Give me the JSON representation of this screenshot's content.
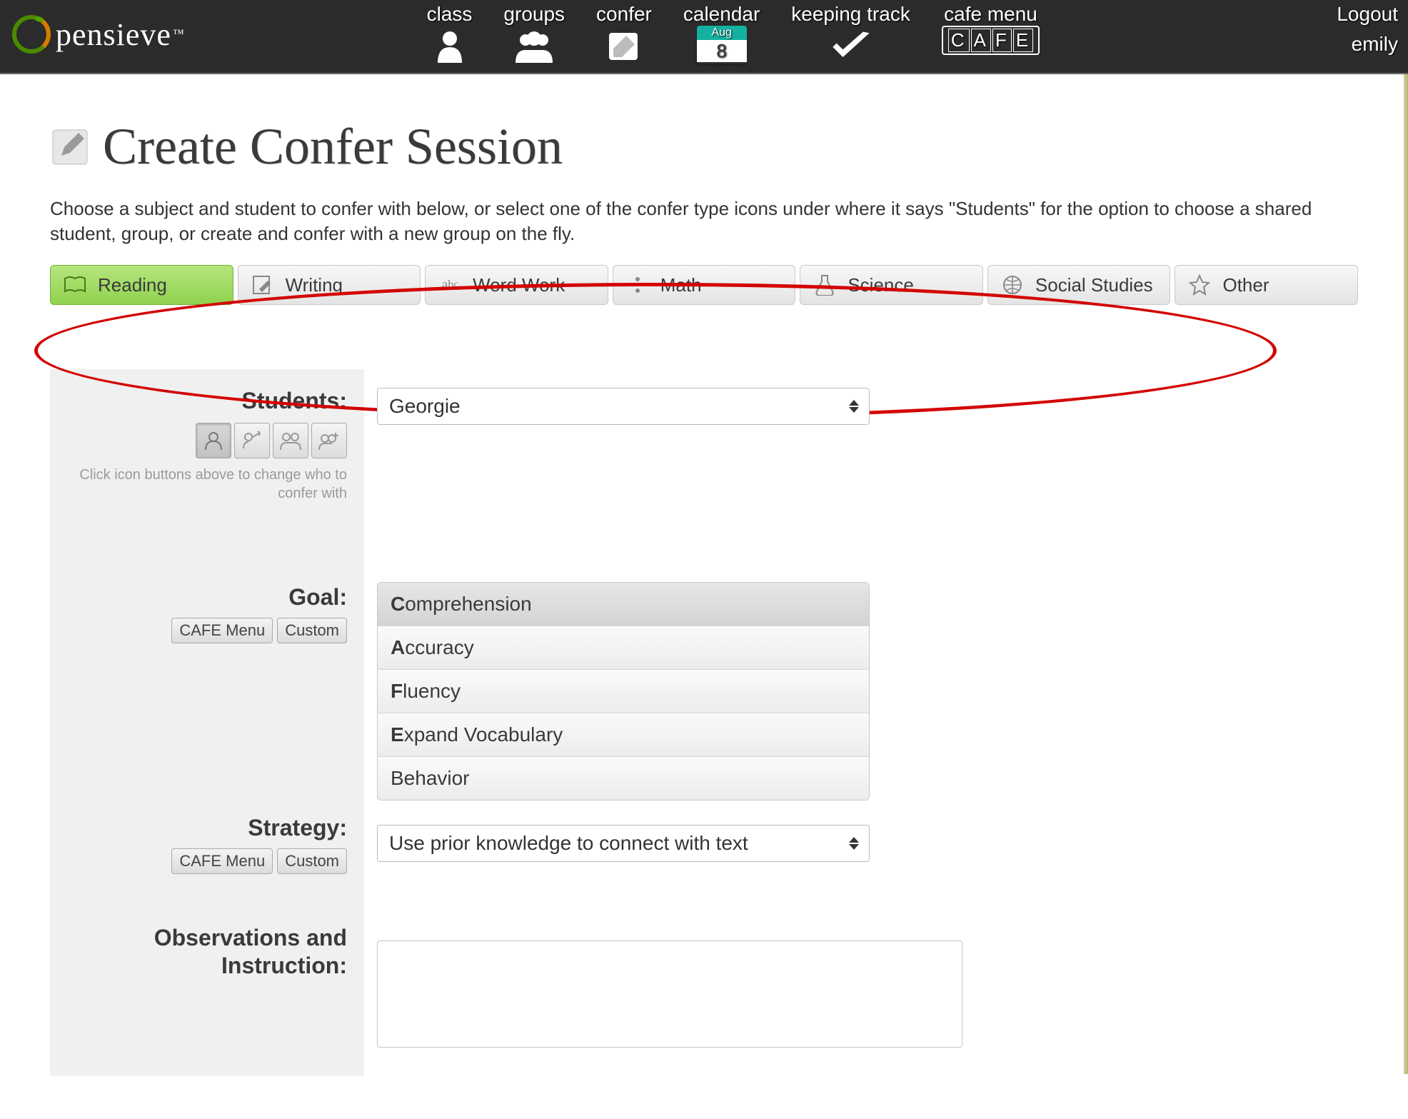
{
  "brand": "pensieve",
  "nav": {
    "class": "class",
    "groups": "groups",
    "confer": "confer",
    "calendar": "calendar",
    "keeping": "keeping track",
    "cafe": "cafe menu",
    "cal_month": "Aug",
    "cal_day": "8"
  },
  "user": {
    "logout": "Logout",
    "name": "emily"
  },
  "page": {
    "title": "Create Confer Session",
    "intro": "Choose a subject and student to confer with below, or select one of the confer type icons under where it says \"Students\" for the option to choose a shared student, group, or create and confer with a new group on the fly."
  },
  "subjects": {
    "reading": "Reading",
    "writing": "Writing",
    "wordwork": "Word Work",
    "math": "Math",
    "science": "Science",
    "social": "Social Studies",
    "other": "Other"
  },
  "labels": {
    "students": "Students:",
    "goal": "Goal:",
    "strategy": "Strategy:",
    "obs": "Observations and Instruction:",
    "cafe_btn": "CAFE Menu",
    "custom_btn": "Custom",
    "helper": "Click icon buttons above to change who to confer with"
  },
  "fields": {
    "student_selected": "Georgie",
    "strategy_selected": "Use prior knowledge to connect with text"
  },
  "goals": {
    "g1_b": "C",
    "g1_r": "omprehension",
    "g2_b": "A",
    "g2_r": "ccuracy",
    "g3_b": "F",
    "g3_r": "luency",
    "g4_b": "E",
    "g4_r": "xpand Vocabulary",
    "g5": "Behavior"
  }
}
